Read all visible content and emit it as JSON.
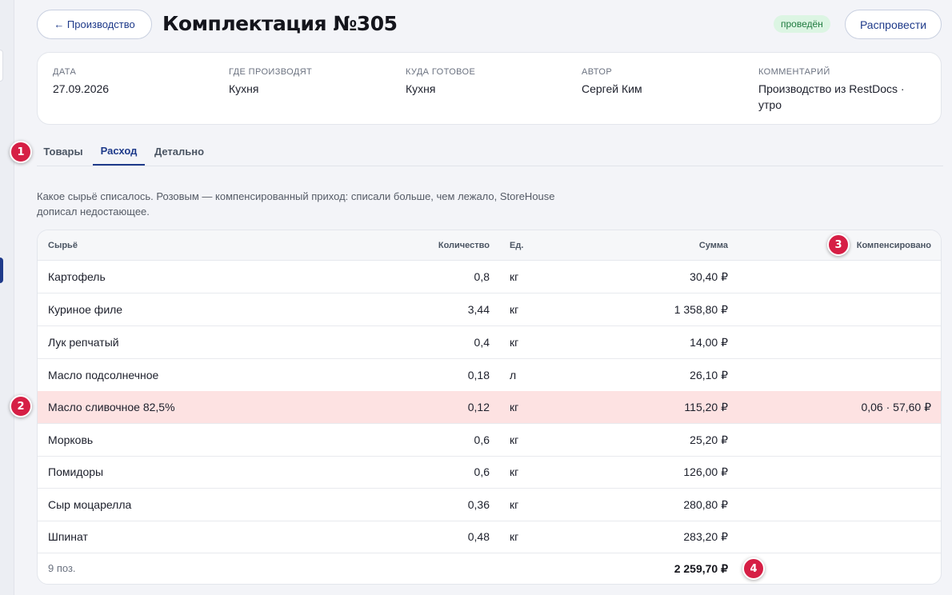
{
  "header": {
    "back_label": "← Производство",
    "title": "Комплектация №305",
    "status": "проведён",
    "unpost_label": "Распровести"
  },
  "info": [
    {
      "label": "ДАТА",
      "value": "27.09.2026"
    },
    {
      "label": "ГДЕ ПРОИЗВОДЯТ",
      "value": "Кухня"
    },
    {
      "label": "КУДА ГОТОВОЕ",
      "value": "Кухня"
    },
    {
      "label": "АВТОР",
      "value": "Сергей Ким"
    },
    {
      "label": "КОММЕНТАРИЙ",
      "value": "Производство из RestDocs · утро"
    }
  ],
  "tabs": [
    {
      "label": "Товары"
    },
    {
      "label": "Расход"
    },
    {
      "label": "Детально"
    }
  ],
  "hint": "Какое сырьё списалось. Розовым — компенсированный приход: списали больше, чем лежало, StoreHouse дописал недостающее.",
  "table": {
    "headers": {
      "name": "Сырьё",
      "qty": "Количество",
      "unit": "Ед.",
      "sum": "Сумма",
      "comp": "Компенсировано"
    },
    "rows": [
      {
        "name": "Картофель",
        "qty": "0,8",
        "unit": "кг",
        "sum": "30,40 ₽",
        "comp": ""
      },
      {
        "name": "Куриное филе",
        "qty": "3,44",
        "unit": "кг",
        "sum": "1 358,80 ₽",
        "comp": ""
      },
      {
        "name": "Лук репчатый",
        "qty": "0,4",
        "unit": "кг",
        "sum": "14,00 ₽",
        "comp": ""
      },
      {
        "name": "Масло подсолнечное",
        "qty": "0,18",
        "unit": "л",
        "sum": "26,10 ₽",
        "comp": ""
      },
      {
        "name": "Масло сливочное 82,5%",
        "qty": "0,12",
        "unit": "кг",
        "sum": "115,20 ₽",
        "comp": "0,06 · 57,60 ₽"
      },
      {
        "name": "Морковь",
        "qty": "0,6",
        "unit": "кг",
        "sum": "25,20 ₽",
        "comp": ""
      },
      {
        "name": "Помидоры",
        "qty": "0,6",
        "unit": "кг",
        "sum": "126,00 ₽",
        "comp": ""
      },
      {
        "name": "Сыр моцарелла",
        "qty": "0,36",
        "unit": "кг",
        "sum": "280,80 ₽",
        "comp": ""
      },
      {
        "name": "Шпинат",
        "qty": "0,48",
        "unit": "кг",
        "sum": "283,20 ₽",
        "comp": ""
      }
    ],
    "footer": {
      "count": "9 поз.",
      "total": "2 259,70 ₽"
    }
  },
  "markers": [
    "1",
    "2",
    "3",
    "4"
  ],
  "colors": {
    "accent": "#1e3a8a",
    "compensated_row": "#fde2e2",
    "marker": "#d61f45",
    "status_bg": "#dcf5e3"
  }
}
